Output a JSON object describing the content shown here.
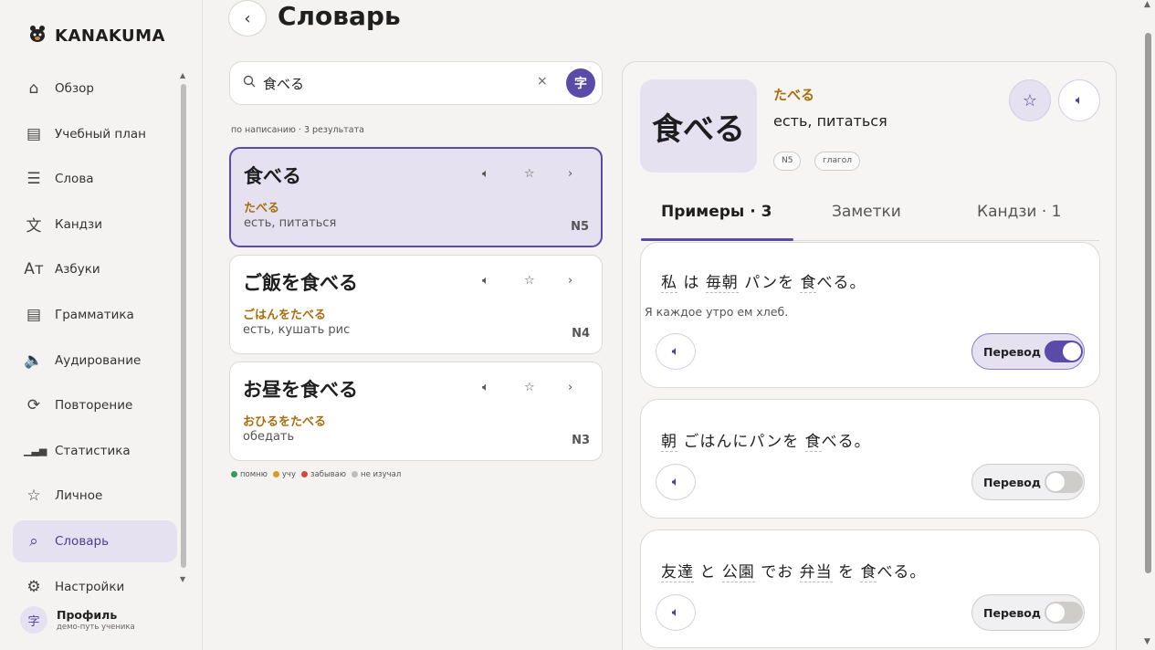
{
  "brand": {
    "name": "KANAKUMA",
    "logo_icon": "bear-paw-icon"
  },
  "nav": [
    {
      "label": "Обзор",
      "icon": "⌂"
    },
    {
      "label": "Учебный план",
      "icon": "▤"
    },
    {
      "label": "Слова",
      "icon": "☰"
    },
    {
      "label": "Кандзи",
      "icon": "文"
    },
    {
      "label": "Азбуки",
      "icon": "Aт"
    },
    {
      "label": "Грамматика",
      "icon": "▤"
    },
    {
      "label": "Аудирование",
      "icon": "🔈"
    },
    {
      "label": "Повторение",
      "icon": "⟳"
    },
    {
      "label": "Статистика",
      "icon": "▁▃▅"
    },
    {
      "label": "Личное",
      "icon": "☆"
    },
    {
      "label": "Словарь",
      "icon": "⌕",
      "active": true
    },
    {
      "label": "Настройки",
      "icon": "⚙"
    }
  ],
  "profile": {
    "name": "Профиль",
    "subtitle": "демо-путь ученика",
    "avatar_glyph": "字"
  },
  "header": {
    "title": "Словарь",
    "back_glyph": "‹"
  },
  "search": {
    "value": "食べる",
    "clear_glyph": "×",
    "kanji_glyph": "字"
  },
  "result_meta": "по написанию · 3 результата",
  "results": [
    {
      "word": "食べる",
      "reading": "たべる",
      "meaning": "есть, питаться",
      "level": "N5",
      "selected": true
    },
    {
      "word": "ご飯を食べる",
      "reading": "ごはんをたべる",
      "meaning": "есть, кушать рис",
      "level": "N4"
    },
    {
      "word": "お昼を食べる",
      "reading": "おひるをたべる",
      "meaning": "обедать",
      "level": "N3"
    }
  ],
  "legend": [
    {
      "label": "помню",
      "color": "#3a9a5b"
    },
    {
      "label": "учу",
      "color": "#d89a1c"
    },
    {
      "label": "забываю",
      "color": "#d24a3e"
    },
    {
      "label": "не изучал",
      "color": "#bdbdbd"
    }
  ],
  "detail": {
    "word": "食べる",
    "reading": "たべる",
    "meaning": "есть, питаться",
    "tags": [
      "N5",
      "глагол"
    ],
    "tabs": [
      "Примеры · 3",
      "Заметки",
      "Кандзи · 1"
    ],
    "translation_label": "Перевод",
    "examples": [
      {
        "segments": [
          "私",
          " は ",
          "毎朝",
          " パンを ",
          "食",
          "べる。"
        ],
        "translation": "Я каждое утро ем хлеб.",
        "translation_on": true
      },
      {
        "segments": [
          "朝",
          " ごはんにパンを ",
          "食",
          "べる。"
        ],
        "translation": "",
        "translation_on": false
      },
      {
        "segments": [
          "友達",
          " と ",
          "公園",
          " でお ",
          "弁当",
          " を ",
          "食",
          "べる。"
        ],
        "translation": "",
        "translation_on": false
      }
    ]
  },
  "colors": {
    "accent": "#5b4ba8",
    "accent_soft": "#e5e1f1",
    "reading": "#a86e0e"
  }
}
